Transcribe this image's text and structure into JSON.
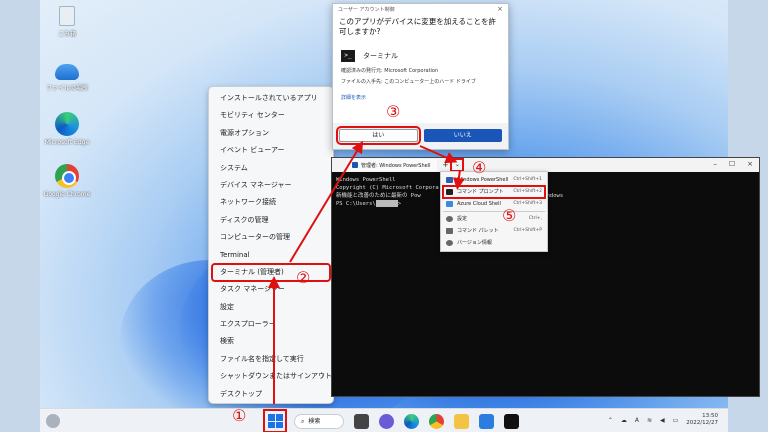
{
  "desktop_icons": [
    {
      "label": "ごみ箱",
      "icon": "recycle-bin-icon"
    },
    {
      "label": "ファイルの場所",
      "icon": "onedrive-icon"
    },
    {
      "label": "Microsoft Edge",
      "icon": "edge-icon"
    },
    {
      "label": "Google Chrome",
      "icon": "chrome-icon"
    }
  ],
  "context_menu": {
    "items": [
      "インストールされているアプリ",
      "モビリティ センター",
      "電源オプション",
      "イベント ビューアー",
      "システム",
      "デバイス マネージャー",
      "ネットワーク接続",
      "ディスクの管理",
      "コンピューターの管理",
      "Terminal",
      "ターミナル (管理者)",
      "タスク マネージャー",
      "設定",
      "エクスプローラー",
      "検索",
      "ファイル名を指定して実行",
      "シャットダウンまたはサインアウト",
      "デスクトップ"
    ],
    "highlight_index": 10
  },
  "uac": {
    "header": "ユーザー アカウント制御",
    "question": "このアプリがデバイスに変更を加えることを許可しますか?",
    "app_name": "ターミナル",
    "publisher_line": "確認済みの発行元: Microsoft Corporation",
    "origin_line": "ファイルの入手先: このコンピューター上のハード ドライブ",
    "details_link": "詳細を表示",
    "yes_label": "はい",
    "no_label": "いいえ"
  },
  "terminal": {
    "tab_title": "管理者: Windows PowerShell",
    "lines": [
      "Windows PowerShell",
      "Copyright (C) Microsoft Corpora",
      "",
      "新機能と改善のために最新の Pow                 \\!https://aka.ms/PSWindows",
      "",
      "PS C:\\Users\\"
    ],
    "prompt_suffix": ">"
  },
  "dropdown": {
    "items": [
      {
        "label": "Windows PowerShell",
        "shortcut": "Ctrl+Shift+1"
      },
      {
        "label": "コマンド プロンプト",
        "shortcut": "Ctrl+Shift+2"
      },
      {
        "label": "Azure Cloud Shell",
        "shortcut": "Ctrl+Shift+3"
      },
      {
        "label": "設定",
        "shortcut": "Ctrl+,"
      },
      {
        "label": "コマンド パレット",
        "shortcut": "Ctrl+Shift+P"
      },
      {
        "label": "バージョン情報",
        "shortcut": ""
      }
    ],
    "highlight_index": 1
  },
  "taskbar": {
    "search_label": "検索",
    "time": "13:50",
    "date": "2022/12/27",
    "ime_label": "A"
  },
  "annotations": [
    "①",
    "②",
    "③",
    "④",
    "⑤"
  ],
  "colors": {
    "highlight": "#e01010",
    "accent": "#1a56b8"
  }
}
